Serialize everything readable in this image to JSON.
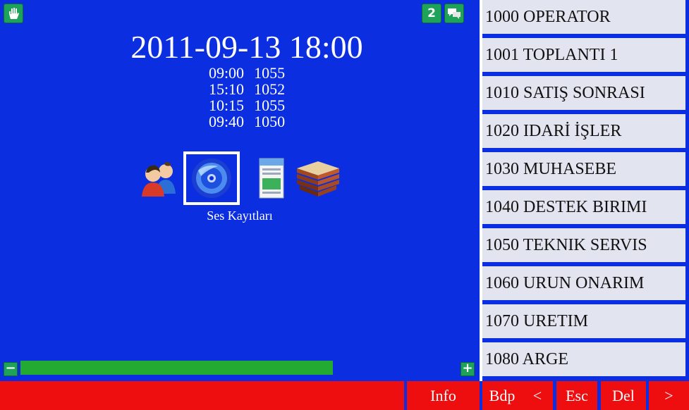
{
  "header": {
    "notification_count": "2"
  },
  "clock": {
    "datetime": "2011-09-13 18:00"
  },
  "recent_records": [
    {
      "time": "09:00",
      "ext": "1055"
    },
    {
      "time": "15:10",
      "ext": "1052"
    },
    {
      "time": "10:15",
      "ext": "1055"
    },
    {
      "time": "09:40",
      "ext": "1050"
    }
  ],
  "apps": {
    "caption": "Ses Kayıtları",
    "icons": [
      "contacts-icon",
      "disc-icon",
      "document-icon",
      "books-icon"
    ]
  },
  "volume": {
    "level": 0.82
  },
  "extensions": [
    "1000 OPERATOR",
    "1001 TOPLANTI  1",
    "1010 SATIŞ SONRASI",
    "1020 IDARİ İŞLER",
    "1030 MUHASEBE",
    "1040 DESTEK BIRIMI",
    "1050 TEKNIK SERVIS",
    "1060 URUN ONARIM",
    "1070 URETIM",
    "1080 ARGE"
  ],
  "bottom_bar": {
    "info": "Info",
    "bdp": "Bdp",
    "back": "<",
    "esc": "Esc",
    "del": "Del",
    "next": ">"
  },
  "colors": {
    "background": "#0a2ee0",
    "accent_green": "#1fa35a",
    "bar_red": "#ee0e10",
    "list_bg": "#e2e4ef"
  }
}
